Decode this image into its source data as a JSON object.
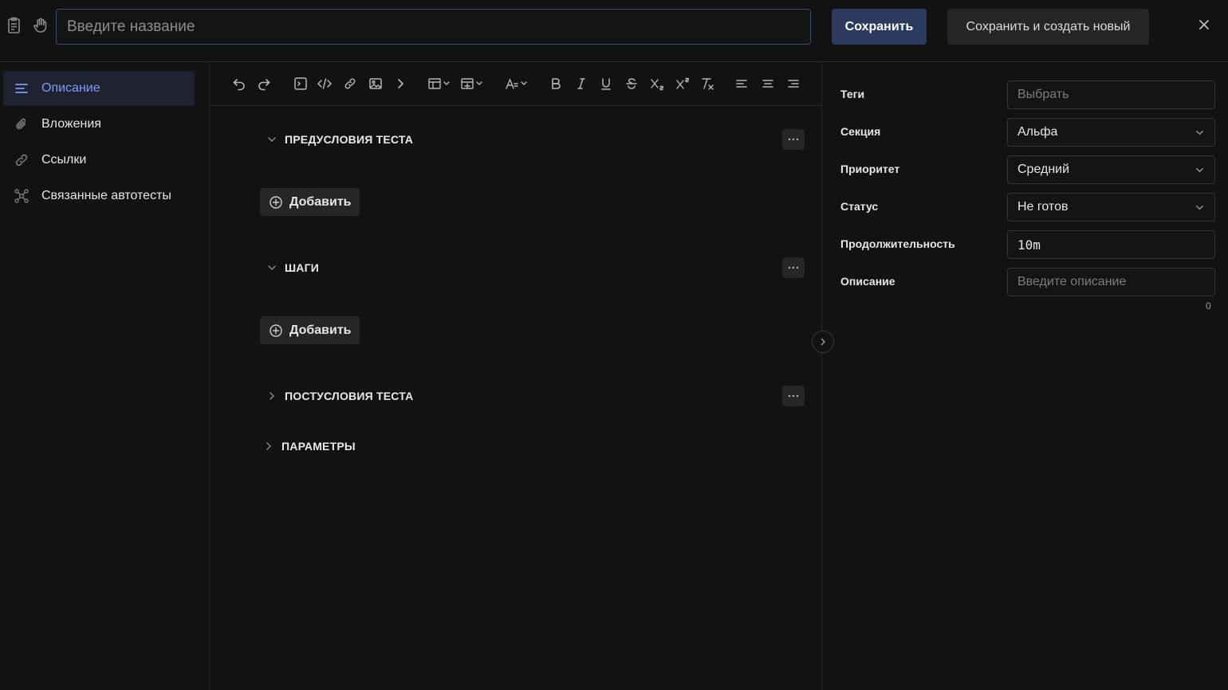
{
  "header": {
    "title_placeholder": "Введите название",
    "save_label": "Сохранить",
    "save_new_label": "Сохранить и создать новый",
    "close_glyph": "×"
  },
  "sidebar": {
    "items": [
      {
        "label": "Описание",
        "icon": "list-icon",
        "active": true
      },
      {
        "label": "Вложения",
        "icon": "paperclip-icon",
        "active": false
      },
      {
        "label": "Ссылки",
        "icon": "link-icon",
        "active": false
      },
      {
        "label": "Связанные автотесты",
        "icon": "network-icon",
        "active": false
      }
    ]
  },
  "toolbar": {
    "items": [
      "undo-icon",
      "redo-icon",
      "code-block-icon",
      "code-inline-icon",
      "link-icon",
      "image-icon",
      "chevron-right-icon",
      "table-icon",
      "table-insert-icon",
      "font-size-icon",
      "bold-icon",
      "italic-icon",
      "underline-icon",
      "strikethrough-icon",
      "subscript-icon",
      "superscript-icon",
      "clear-format-icon",
      "align-left-icon",
      "align-center-icon",
      "align-right-icon"
    ]
  },
  "editor": {
    "sections": [
      {
        "title": "ПРЕДУСЛОВИЯ ТЕСТА",
        "expanded": true,
        "add_label": "Добавить"
      },
      {
        "title": "ШАГИ",
        "expanded": true,
        "add_label": "Добавить"
      },
      {
        "title": "ПОСТУСЛОВИЯ ТЕСТА",
        "expanded": false
      },
      {
        "title": "ПАРАМЕТРЫ",
        "expanded": false
      }
    ]
  },
  "properties": {
    "tags": {
      "label": "Теги",
      "placeholder": "Выбрать"
    },
    "section": {
      "label": "Секция",
      "value": "Альфа"
    },
    "priority": {
      "label": "Приоритет",
      "value": "Средний"
    },
    "status": {
      "label": "Статус",
      "value": "Не готов"
    },
    "duration": {
      "label": "Продолжительность",
      "value": "10m"
    },
    "description": {
      "label": "Описание",
      "placeholder": "Введите описание",
      "counter": "0"
    }
  },
  "colors": {
    "accent": "#7f9cf5",
    "primary_button": "#2b3a5e",
    "background": "#121212"
  }
}
